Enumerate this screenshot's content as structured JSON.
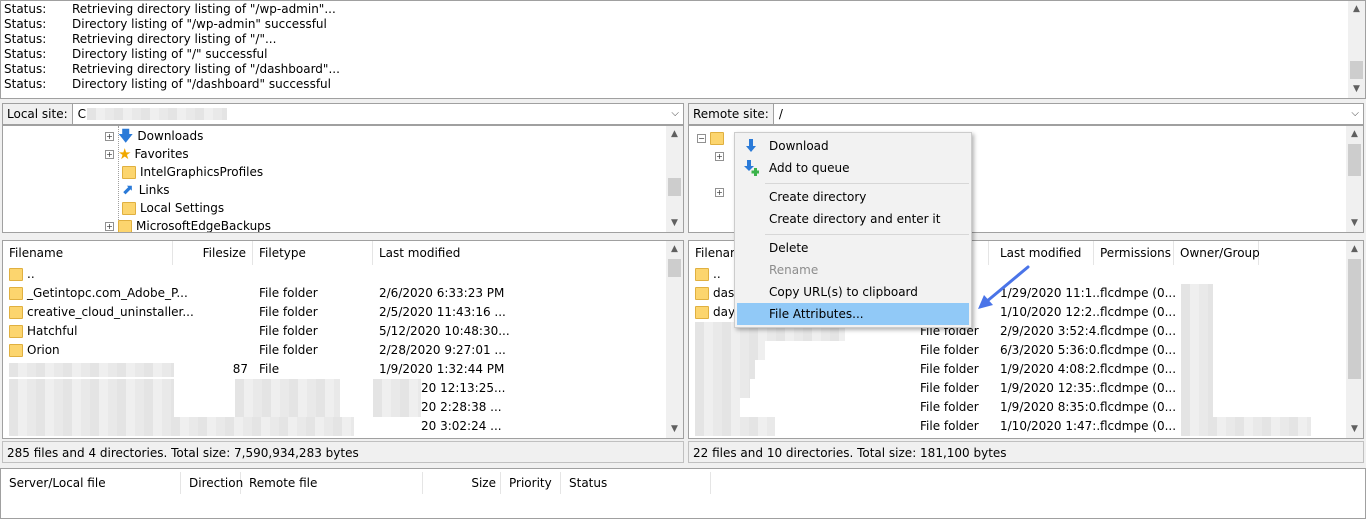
{
  "log": [
    {
      "type": "Status:",
      "msg": "Retrieving directory listing of \"/wp-admin\"..."
    },
    {
      "type": "Status:",
      "msg": "Directory listing of \"/wp-admin\" successful"
    },
    {
      "type": "Status:",
      "msg": "Retrieving directory listing of \"/\"..."
    },
    {
      "type": "Status:",
      "msg": "Directory listing of \"/\" successful"
    },
    {
      "type": "Status:",
      "msg": "Retrieving directory listing of \"/dashboard\"..."
    },
    {
      "type": "Status:",
      "msg": "Directory listing of \"/dashboard\" successful"
    }
  ],
  "local": {
    "site_label": "Local site:",
    "site_path": "C",
    "tree": [
      "Downloads",
      "Favorites",
      "IntelGraphicsProfiles",
      "Links",
      "Local Settings",
      "MicrosoftEdgeBackups"
    ],
    "columns": [
      "Filename",
      "Filesize",
      "Filetype",
      "Last modified"
    ],
    "files": [
      {
        "name": "..",
        "size": "",
        "type": "",
        "modified": ""
      },
      {
        "name": "_Getintopc.com_Adobe_P...",
        "size": "",
        "type": "File folder",
        "modified": "2/6/2020 6:33:23 PM"
      },
      {
        "name": "creative_cloud_uninstaller...",
        "size": "",
        "type": "File folder",
        "modified": "2/5/2020 11:43:16 ..."
      },
      {
        "name": "Hatchful",
        "size": "",
        "type": "File folder",
        "modified": "5/12/2020 10:48:30..."
      },
      {
        "name": "Orion",
        "size": "",
        "type": "File folder",
        "modified": "2/28/2020 9:27:01 ..."
      },
      {
        "name": "",
        "size": "87",
        "type": "File",
        "modified": "1/9/2020 1:32:44 PM"
      },
      {
        "name": "",
        "size": "",
        "type": "",
        "modified": "20 12:13:25..."
      },
      {
        "name": "",
        "size": "",
        "type": "",
        "modified": "20 2:28:38 ..."
      },
      {
        "name": "",
        "size": "",
        "type": "",
        "modified": "20 3:02:24 ..."
      }
    ],
    "status": "285 files and 4 directories. Total size: 7,590,934,283 bytes"
  },
  "remote": {
    "site_label": "Remote site:",
    "site_path": "/",
    "columns": [
      "Filenam",
      "Last modified",
      "Permissions",
      "Owner/Group"
    ],
    "files": [
      {
        "name": "..",
        "type": "",
        "modified": "",
        "perm": ""
      },
      {
        "name": "dash",
        "type": "",
        "modified": "1/29/2020 11:1...",
        "perm": "flcdmpe (0..."
      },
      {
        "name": "dayb",
        "type": "",
        "modified": "1/10/2020 12:2...",
        "perm": "flcdmpe (0..."
      },
      {
        "name": "",
        "type": "File folder",
        "modified": "2/9/2020 3:52:4...",
        "perm": "flcdmpe (0..."
      },
      {
        "name": "",
        "type": "File folder",
        "modified": "6/3/2020 5:36:0...",
        "perm": "flcdmpe (0..."
      },
      {
        "name": "",
        "type": "File folder",
        "modified": "1/9/2020 4:08:2...",
        "perm": "flcdmpe (0..."
      },
      {
        "name": "",
        "type": "File folder",
        "modified": "1/9/2020 12:35:...",
        "perm": "flcdmpe (0..."
      },
      {
        "name": "",
        "type": "File folder",
        "modified": "1/9/2020 8:35:0...",
        "perm": "flcdmpe (0..."
      },
      {
        "name": "",
        "type": "File folder",
        "modified": "1/10/2020 1:47:...",
        "perm": "flcdmpe (0..."
      }
    ],
    "status": "22 files and 10 directories. Total size: 181,100 bytes"
  },
  "context_menu": [
    {
      "label": "Download",
      "icon": "download-icon",
      "enabled": true
    },
    {
      "label": "Add to queue",
      "icon": "add-to-queue-icon",
      "enabled": true
    },
    {
      "label": "Create directory",
      "enabled": true
    },
    {
      "label": "Create directory and enter it",
      "enabled": true
    },
    {
      "label": "Delete",
      "enabled": true
    },
    {
      "label": "Rename",
      "enabled": false
    },
    {
      "label": "Copy URL(s) to clipboard",
      "enabled": true
    },
    {
      "label": "File Attributes...",
      "enabled": true,
      "highlighted": true
    }
  ],
  "queue": {
    "columns": [
      "Server/Local file",
      "Direction",
      "Remote file",
      "Size",
      "Priority",
      "Status"
    ]
  },
  "colors": {
    "highlight": "#91c9f7",
    "arrow": "#4a74e8",
    "folder": "#fcd56e"
  }
}
